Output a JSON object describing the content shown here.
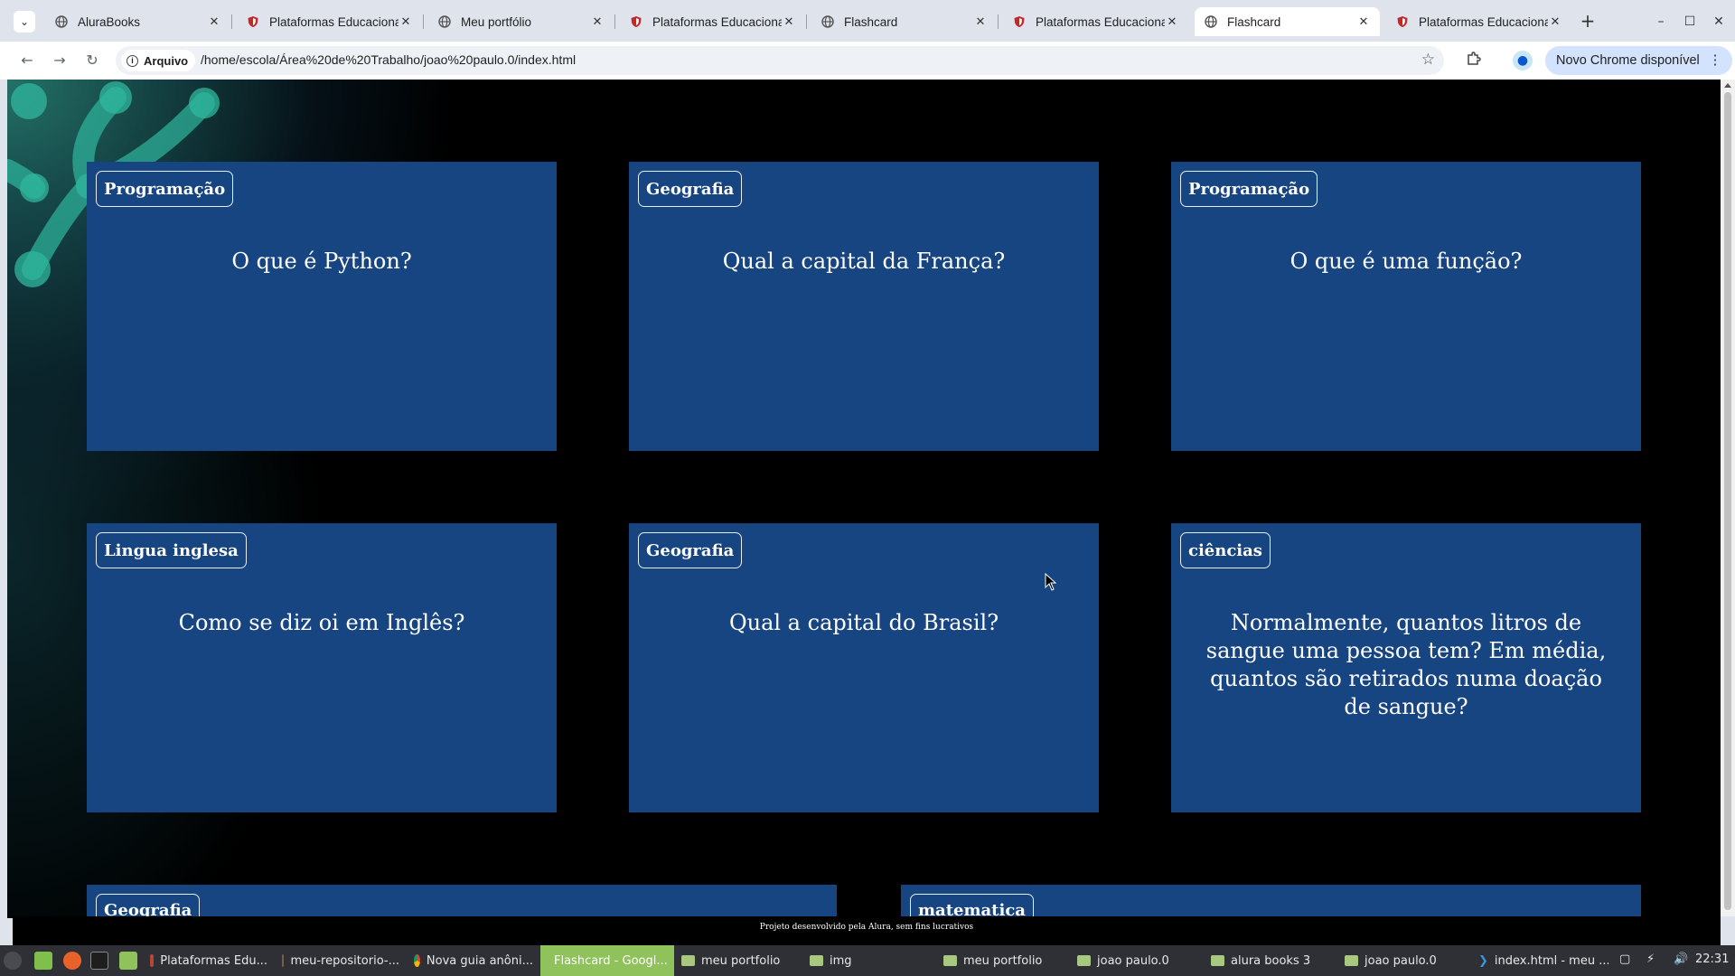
{
  "browser": {
    "tabs": [
      {
        "title": "AluraBooks",
        "icon": "globe-icon",
        "active": false
      },
      {
        "title": "Plataformas Educaciona",
        "icon": "shield-icon",
        "active": false
      },
      {
        "title": "Meu portfólio",
        "icon": "globe-icon",
        "active": false
      },
      {
        "title": "Plataformas Educaciona",
        "icon": "shield-icon",
        "active": false
      },
      {
        "title": "Flashcard",
        "icon": "globe-icon",
        "active": false
      },
      {
        "title": "Plataformas Educaciona",
        "icon": "shield-icon",
        "active": false
      },
      {
        "title": "Flashcard",
        "icon": "globe-icon",
        "active": true
      },
      {
        "title": "Plataformas Educaciona",
        "icon": "shield-icon",
        "active": false
      }
    ],
    "close_glyph": "✕",
    "new_tab_glyph": "+",
    "address": {
      "chip_label": "Arquivo",
      "url": "/home/escola/Área%20de%20Trabalho/joao%20paulo.0/index.html"
    },
    "update_button": "Novo Chrome disponível"
  },
  "page": {
    "cards": [
      {
        "category": "Programação",
        "question": "O que é Python?"
      },
      {
        "category": "Geografia",
        "question": "Qual a capital da França?"
      },
      {
        "category": "Programação",
        "question": "O que é uma função?"
      },
      {
        "category": "Lingua inglesa",
        "question": "Como se diz oi em Inglês?"
      },
      {
        "category": "Geografia",
        "question": "Qual a capital do Brasil?"
      },
      {
        "category": "ciências",
        "question": "Normalmente, quantos litros de sangue uma pessoa tem? Em média, quantos são retirados numa doação de sangue?"
      },
      {
        "category": "Geografia",
        "question": ""
      },
      {
        "category": "matematica",
        "question": ""
      }
    ],
    "footer_text": "Projeto desenvolvido pela Alura, sem fins lucrativos",
    "colors": {
      "card": "#174582",
      "background": "#000000",
      "accent": "#2a9d8f"
    }
  },
  "taskbar": {
    "items": [
      {
        "label": "Plataformas Edu...",
        "icon": "app-icon",
        "active": false
      },
      {
        "label": "meu-repositorio-...",
        "icon": "app-icon",
        "active": false
      },
      {
        "label": "Nova guia anôni...",
        "icon": "chrome-icon",
        "active": false
      },
      {
        "label": "Flashcard - Googl...",
        "icon": "chrome-icon",
        "active": true
      },
      {
        "label": "meu portfolio",
        "icon": "folder-icon",
        "active": false
      },
      {
        "label": "img",
        "icon": "folder-icon",
        "active": false
      },
      {
        "label": "meu portfolio",
        "icon": "folder-icon",
        "active": false
      },
      {
        "label": "joao paulo.0",
        "icon": "folder-icon",
        "active": false
      },
      {
        "label": "alura books 3",
        "icon": "folder-icon",
        "active": false
      },
      {
        "label": "joao paulo.0",
        "icon": "folder-icon",
        "active": false
      },
      {
        "label": "index.html - meu ...",
        "icon": "vscode-icon",
        "active": false
      }
    ],
    "clock": "22:31"
  }
}
